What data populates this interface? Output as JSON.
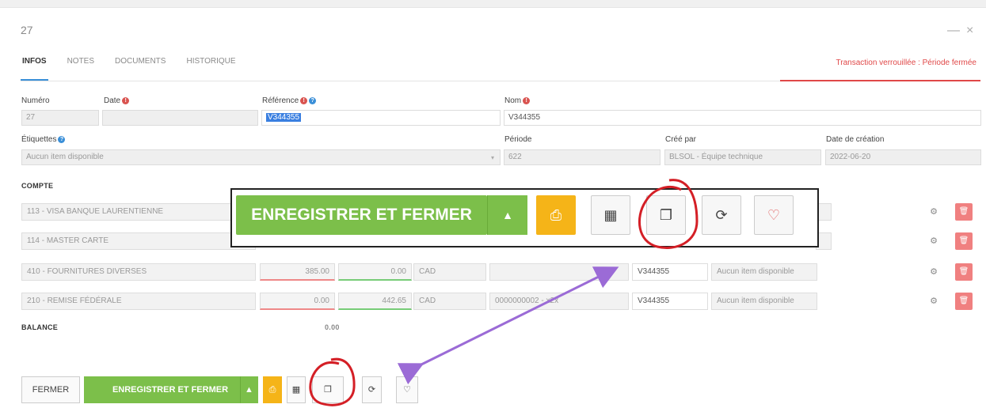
{
  "window": {
    "title": "27",
    "minimize_icon": "—",
    "close_icon": "×"
  },
  "tabs": [
    {
      "label": "INFOS",
      "active": true
    },
    {
      "label": "NOTES"
    },
    {
      "label": "DOCUMENTS"
    },
    {
      "label": "HISTORIQUE"
    }
  ],
  "lock_notice": "Transaction verrouillée : Période fermée",
  "form": {
    "numero_label": "Numéro",
    "numero_value": "27",
    "date_label": "Date",
    "reference_label": "Référence",
    "reference_value": "V344355",
    "nom_label": "Nom",
    "nom_value": "V344355",
    "etiquettes_label": "Étiquettes",
    "etiquettes_value": "Aucun item disponible",
    "periode_label": "Période",
    "periode_value": "622",
    "cree_par_label": "Créé par",
    "cree_par_value": "BLSOL - Équipe technique",
    "date_creation_label": "Date de création",
    "date_creation_value": "2022-06-20"
  },
  "compte_header": "COMPTE",
  "rows": [
    {
      "compte": "113 - VISA BANQUE LAURENTIENNE"
    },
    {
      "compte": "114 - MASTER CARTE"
    },
    {
      "compte": "410 - FOURNITURES DIVERSES",
      "debit": "385.00",
      "credit": "0.00",
      "devise": "CAD",
      "ref": "V344355",
      "tag": "Aucun item disponible"
    },
    {
      "compte": "210 - REMISE FÉDÉRALE",
      "debit": "0.00",
      "credit": "442.65",
      "devise": "CAD",
      "desc": "0000000002 - x2x",
      "ref": "V344355",
      "tag": "Aucun item disponible"
    }
  ],
  "balance_label": "BALANCE",
  "balance_value": "0.00",
  "callout": {
    "save_close_label": "ENREGISTRER ET FERMER"
  },
  "footer": {
    "close_label": "FERMER",
    "save_close_label": "ENREGISTRER ET FERMER"
  },
  "colors": {
    "green": "#7cbf4a",
    "orange": "#f5b418",
    "red": "#e04848",
    "blue": "#3a8fd8",
    "annotation_red": "#d41f26",
    "annotation_purple": "#9b6bd6"
  }
}
